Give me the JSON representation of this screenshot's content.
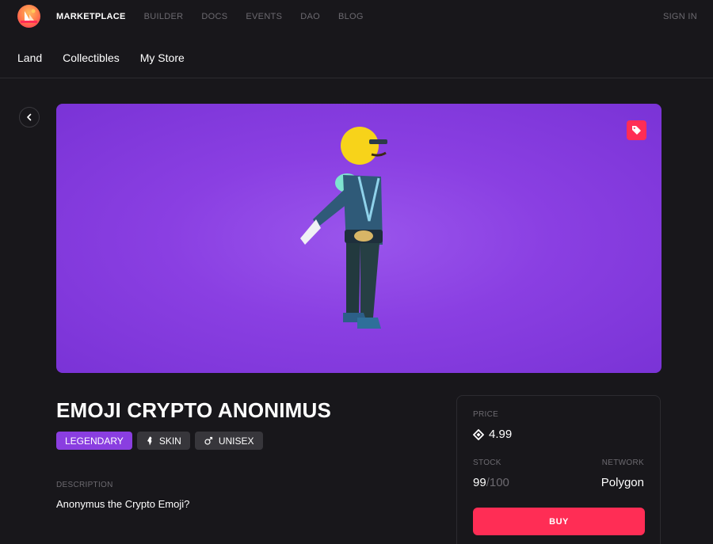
{
  "topnav": {
    "links": [
      "MARKETPLACE",
      "BUILDER",
      "DOCS",
      "EVENTS",
      "DAO",
      "BLOG"
    ],
    "sign_in": "SIGN IN"
  },
  "subnav": {
    "items": [
      "Land",
      "Collectibles",
      "My Store"
    ]
  },
  "hero": {
    "background_color": "#8a3fe2",
    "tag_icon": "tag-icon"
  },
  "item": {
    "title": "EMOJI CRYPTO ANONIMUS",
    "badges": {
      "rarity": "LEGENDARY",
      "category": "SKIN",
      "gender": "UNISEX"
    },
    "description_label": "DESCRIPTION",
    "description": "Anonymus the Crypto Emoji?"
  },
  "buy_card": {
    "price_label": "PRICE",
    "price": "4.99",
    "stock_label": "STOCK",
    "stock_available": "99",
    "stock_total": "/100",
    "network_label": "NETWORK",
    "network": "Polygon",
    "buy_label": "BUY"
  },
  "colors": {
    "accent": "#ff2d55",
    "rarity_legendary": "#8a3ee0",
    "background": "#18171b"
  }
}
